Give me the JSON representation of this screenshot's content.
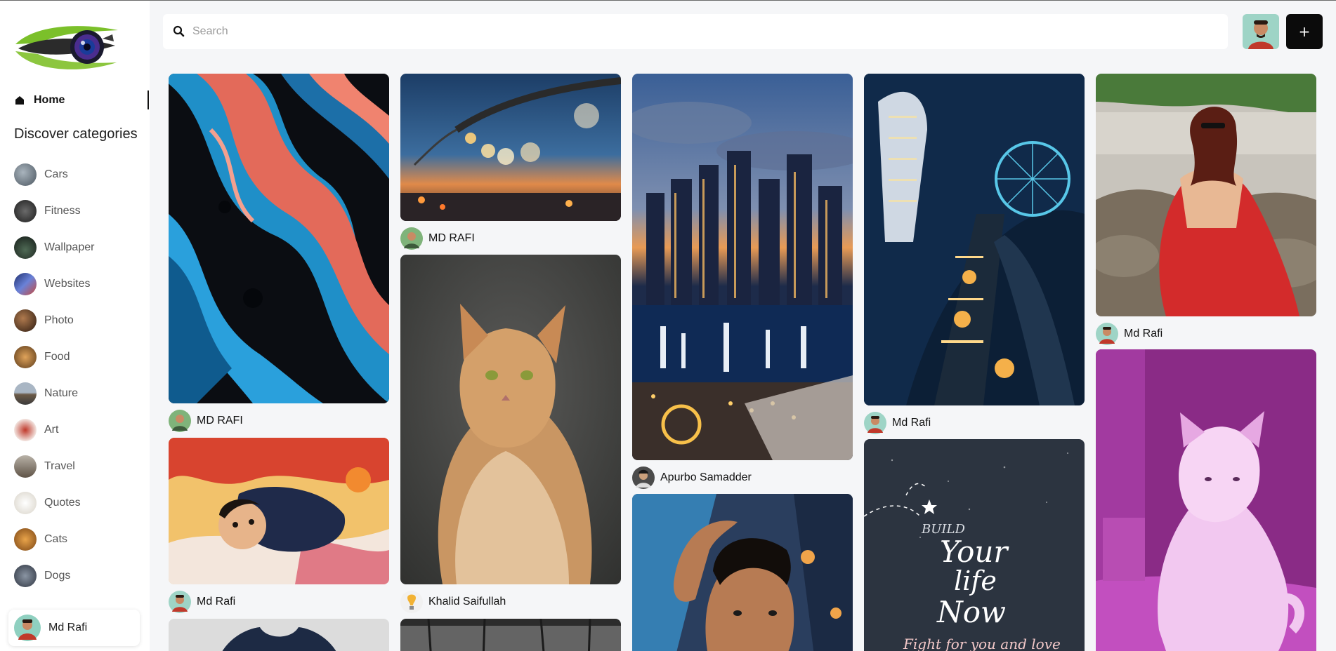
{
  "nav": {
    "home_label": "Home",
    "discover_title": "Discover categories"
  },
  "categories": [
    {
      "label": "Cars",
      "color": "#6f7c86"
    },
    {
      "label": "Fitness",
      "color": "#3a3a3a"
    },
    {
      "label": "Wallpaper",
      "color": "#2f3b33"
    },
    {
      "label": "Websites",
      "color": "#334a8c"
    },
    {
      "label": "Photo",
      "color": "#5a3a28"
    },
    {
      "label": "Food",
      "color": "#a5733e"
    },
    {
      "label": "Nature",
      "color": "#6d7682"
    },
    {
      "label": "Art",
      "color": "#d9b3a8"
    },
    {
      "label": "Travel",
      "color": "#7a6b5e"
    },
    {
      "label": "Quotes",
      "color": "#e6e2d9"
    },
    {
      "label": "Cats",
      "color": "#c8822f"
    },
    {
      "label": "Dogs",
      "color": "#5b6572"
    }
  ],
  "user": {
    "name": "Md Rafi"
  },
  "search": {
    "placeholder": "Search"
  },
  "header": {
    "add_label": "+"
  },
  "pins": {
    "p1": {
      "author": "MD RAFI"
    },
    "p2": {
      "author": "Md Rafi"
    },
    "p3": {
      "author": "MD RAFI"
    },
    "p4": {
      "author": "Khalid Saifullah"
    },
    "p5": {
      "author": "Apurbo Samadder"
    },
    "p6": {
      "author": "Md Rafi"
    },
    "p7": {
      "author": "Md Rafi"
    }
  },
  "quote_image": {
    "line1": "BUILD",
    "line2": "Your",
    "line3": "life",
    "line4": "Now",
    "line5": "Fight for you and love"
  },
  "colors": {
    "accent": "#0b0b0b",
    "background": "#f5f6f8"
  }
}
